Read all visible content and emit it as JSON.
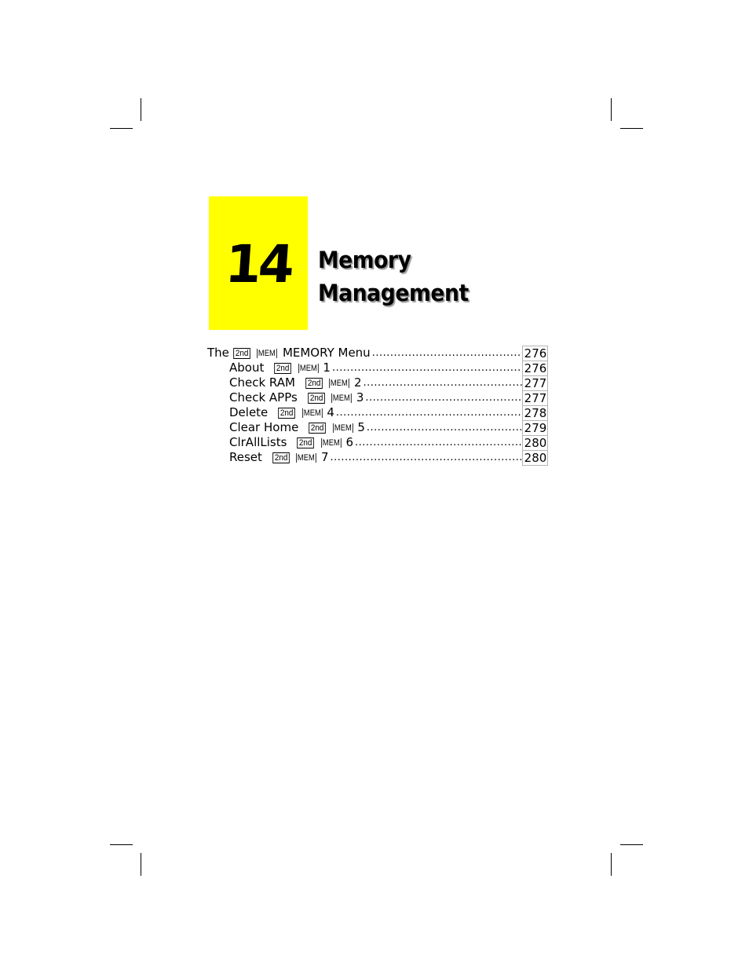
{
  "chapter": {
    "number": "14",
    "title_line1": "Memory",
    "title_line2": "Management",
    "box_color": "#ffff00"
  },
  "toc": {
    "main": {
      "prefix": "The",
      "key1": "2nd",
      "key2": "MEM",
      "label": "MEMORY Menu",
      "page": "276"
    },
    "items": [
      {
        "label": "About",
        "key1": "2nd",
        "key2": "MEM",
        "num": "1",
        "page": "276"
      },
      {
        "label": "Check RAM",
        "key1": "2nd",
        "key2": "MEM",
        "num": "2",
        "page": "277"
      },
      {
        "label": "Check APPs",
        "key1": "2nd",
        "key2": "MEM",
        "num": "3",
        "page": "277"
      },
      {
        "label": "Delete",
        "key1": "2nd",
        "key2": "MEM",
        "num": "4",
        "page": "278"
      },
      {
        "label": "Clear Home",
        "key1": "2nd",
        "key2": "MEM",
        "num": "5",
        "page": "279"
      },
      {
        "label": "ClrAllLists",
        "key1": "2nd",
        "key2": "MEM",
        "num": "6",
        "page": "280"
      },
      {
        "label": "Reset",
        "key1": "2nd",
        "key2": "MEM",
        "num": "7",
        "page": "280"
      }
    ]
  }
}
